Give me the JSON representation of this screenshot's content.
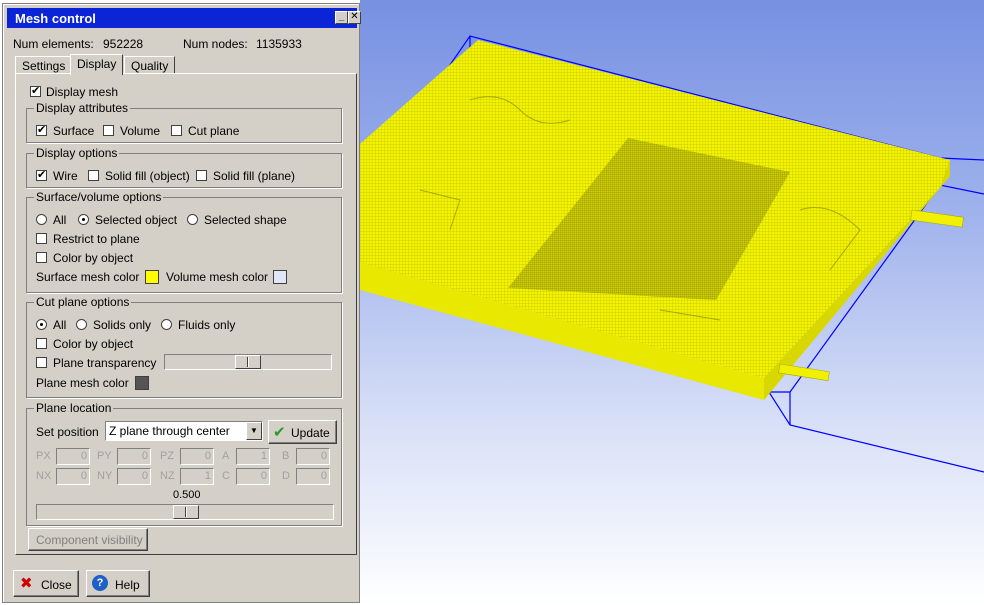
{
  "window": {
    "title": "Mesh control",
    "num_elements_label": "Num elements:",
    "num_elements": "952228",
    "num_nodes_label": "Num nodes:",
    "num_nodes": "1135933"
  },
  "tabs": [
    "Settings",
    "Display",
    "Quality"
  ],
  "active_tab": "Display",
  "display": {
    "display_mesh": "Display mesh",
    "display_attributes": {
      "title": "Display attributes",
      "surface": "Surface",
      "volume": "Volume",
      "cut_plane": "Cut plane"
    },
    "display_options": {
      "title": "Display options",
      "wire": "Wire",
      "solid_fill_object": "Solid fill (object)",
      "solid_fill_plane": "Solid fill (plane)"
    },
    "surface_volume_options": {
      "title": "Surface/volume options",
      "all": "All",
      "selected_object": "Selected object",
      "selected_shape": "Selected shape",
      "restrict_to_plane": "Restrict to plane",
      "color_by_object": "Color by object",
      "surface_mesh_color_label": "Surface mesh color",
      "volume_mesh_color_label": "Volume mesh color",
      "surface_mesh_color": "#ffff00",
      "volume_mesh_color": "#e0e6f8"
    },
    "cut_plane_options": {
      "title": "Cut plane options",
      "all": "All",
      "solids_only": "Solids only",
      "fluids_only": "Fluids only",
      "color_by_object": "Color by object",
      "plane_transparency": "Plane transparency",
      "plane_mesh_color_label": "Plane mesh color",
      "plane_mesh_color": "#555555"
    },
    "plane_location": {
      "title": "Plane location",
      "set_position_label": "Set position",
      "set_position_value": "Z plane through center",
      "update": "Update",
      "fields": [
        {
          "label": "PX",
          "value": "0"
        },
        {
          "label": "PY",
          "value": "0"
        },
        {
          "label": "PZ",
          "value": "0"
        },
        {
          "label": "A",
          "value": "1"
        },
        {
          "label": "B",
          "value": "0"
        },
        {
          "label": "NX",
          "value": "0"
        },
        {
          "label": "NY",
          "value": "0"
        },
        {
          "label": "NZ",
          "value": "1"
        },
        {
          "label": "C",
          "value": "0"
        },
        {
          "label": "D",
          "value": "0"
        }
      ],
      "slider_value": "0.500"
    },
    "component_visibility": "Component visibility"
  },
  "buttons": {
    "close": "Close",
    "help": "Help"
  },
  "viewport": {
    "mesh_color": "#ffff00",
    "bbox_color": "#0000ff"
  }
}
